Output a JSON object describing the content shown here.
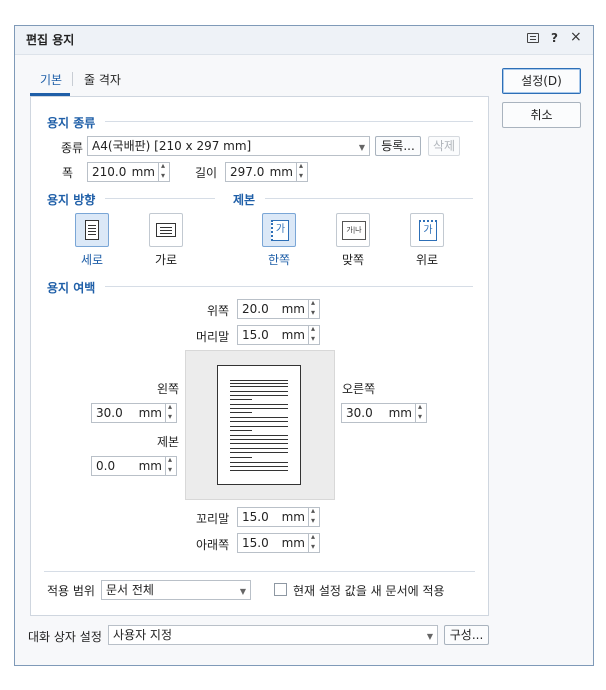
{
  "title": "편집 용지",
  "titlebar_icons": {
    "help": "?",
    "close": "×"
  },
  "tabs": [
    {
      "label": "기본"
    },
    {
      "label": "줄 격자"
    }
  ],
  "buttons": {
    "ok": "설정(D)",
    "cancel": "취소",
    "register": "등록...",
    "delete": "삭제",
    "config": "구성..."
  },
  "paper_type": {
    "section": "용지 종류",
    "kind_label": "종류",
    "kind_value": "A4(국배판) [210 x 297 mm]",
    "width_label": "폭",
    "width_value": "210.0",
    "length_label": "길이",
    "length_value": "297.0",
    "unit": "mm"
  },
  "orientation": {
    "section": "용지 방향",
    "options": [
      {
        "label": "세로",
        "selected": true
      },
      {
        "label": "가로",
        "selected": false
      }
    ]
  },
  "binding": {
    "section": "제본",
    "options": [
      {
        "label": "한쪽",
        "selected": true,
        "icon_text": "가"
      },
      {
        "label": "맞쪽",
        "selected": false,
        "icon_text": "가|나"
      },
      {
        "label": "위로",
        "selected": false,
        "icon_text": "가"
      }
    ]
  },
  "margins": {
    "section": "용지 여백",
    "top_label": "위쪽",
    "top_value": "20.0",
    "header_label": "머리말",
    "header_value": "15.0",
    "left_label": "왼쪽",
    "left_value": "30.0",
    "right_label": "오른쪽",
    "right_value": "30.0",
    "gutter_label": "제본",
    "gutter_value": "0.0",
    "footer_label": "꼬리말",
    "footer_value": "15.0",
    "bottom_label": "아래쪽",
    "bottom_value": "15.0",
    "unit": "mm"
  },
  "apply": {
    "label": "적용 범위",
    "value": "문서 전체",
    "checkbox_label": "현재 설정 값을 새 문서에 적용",
    "checked": false
  },
  "dialog_settings": {
    "label": "대화 상자 설정",
    "value": "사용자 지정"
  }
}
